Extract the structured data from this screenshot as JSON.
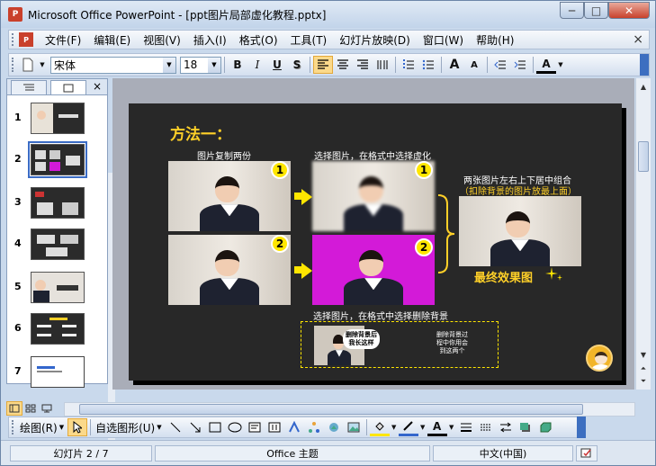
{
  "window": {
    "title": "Microsoft Office PowerPoint - [ppt图片局部虚化教程.pptx]",
    "app_icon": "P",
    "min_glyph": "─",
    "max_glyph": "□",
    "close_glyph": "✕"
  },
  "menu": {
    "doc_icon": "P",
    "items": [
      "文件(F)",
      "编辑(E)",
      "视图(V)",
      "插入(I)",
      "格式(O)",
      "工具(T)",
      "幻灯片放映(D)",
      "窗口(W)",
      "帮助(H)"
    ],
    "close_glyph": "×"
  },
  "toolbar": {
    "font_name": "宋体",
    "font_size": "18",
    "bold": "B",
    "italic": "I",
    "underline": "U",
    "shadow": "S",
    "grow_font": "A",
    "shrink_font": "A",
    "font_color": "A"
  },
  "panel": {
    "close_glyph": "×",
    "slides": [
      {
        "num": "1"
      },
      {
        "num": "2"
      },
      {
        "num": "3"
      },
      {
        "num": "4"
      },
      {
        "num": "5"
      },
      {
        "num": "6"
      },
      {
        "num": "7"
      }
    ]
  },
  "slide": {
    "title": "方法一：",
    "cap_copy": "图片复制两份",
    "cap_blur": "选择图片，在格式中选择虚化",
    "cap_combine": "两张图片左右上下居中组合",
    "cap_combine_note": "（扣除背景的图片放最上面）",
    "cap_remove": "选择图片，在格式中选择删除背景",
    "badge1": "1",
    "badge2": "2",
    "final_label": "最终效果图",
    "balloon": "删除背景后\n我长这样",
    "note_right": "删除背景过\n程中你用会\n到这两个"
  },
  "drawbar": {
    "draw_label": "绘图(R)",
    "autoshape_label": "自选图形(U)"
  },
  "status": {
    "slide_pos": "幻灯片 2 / 7",
    "theme": "Office 主题",
    "language": "中文(中国)"
  },
  "colors": {
    "slide_bg": "#282828",
    "accent_yellow": "#ffd028",
    "magenta": "#d31ad8"
  }
}
